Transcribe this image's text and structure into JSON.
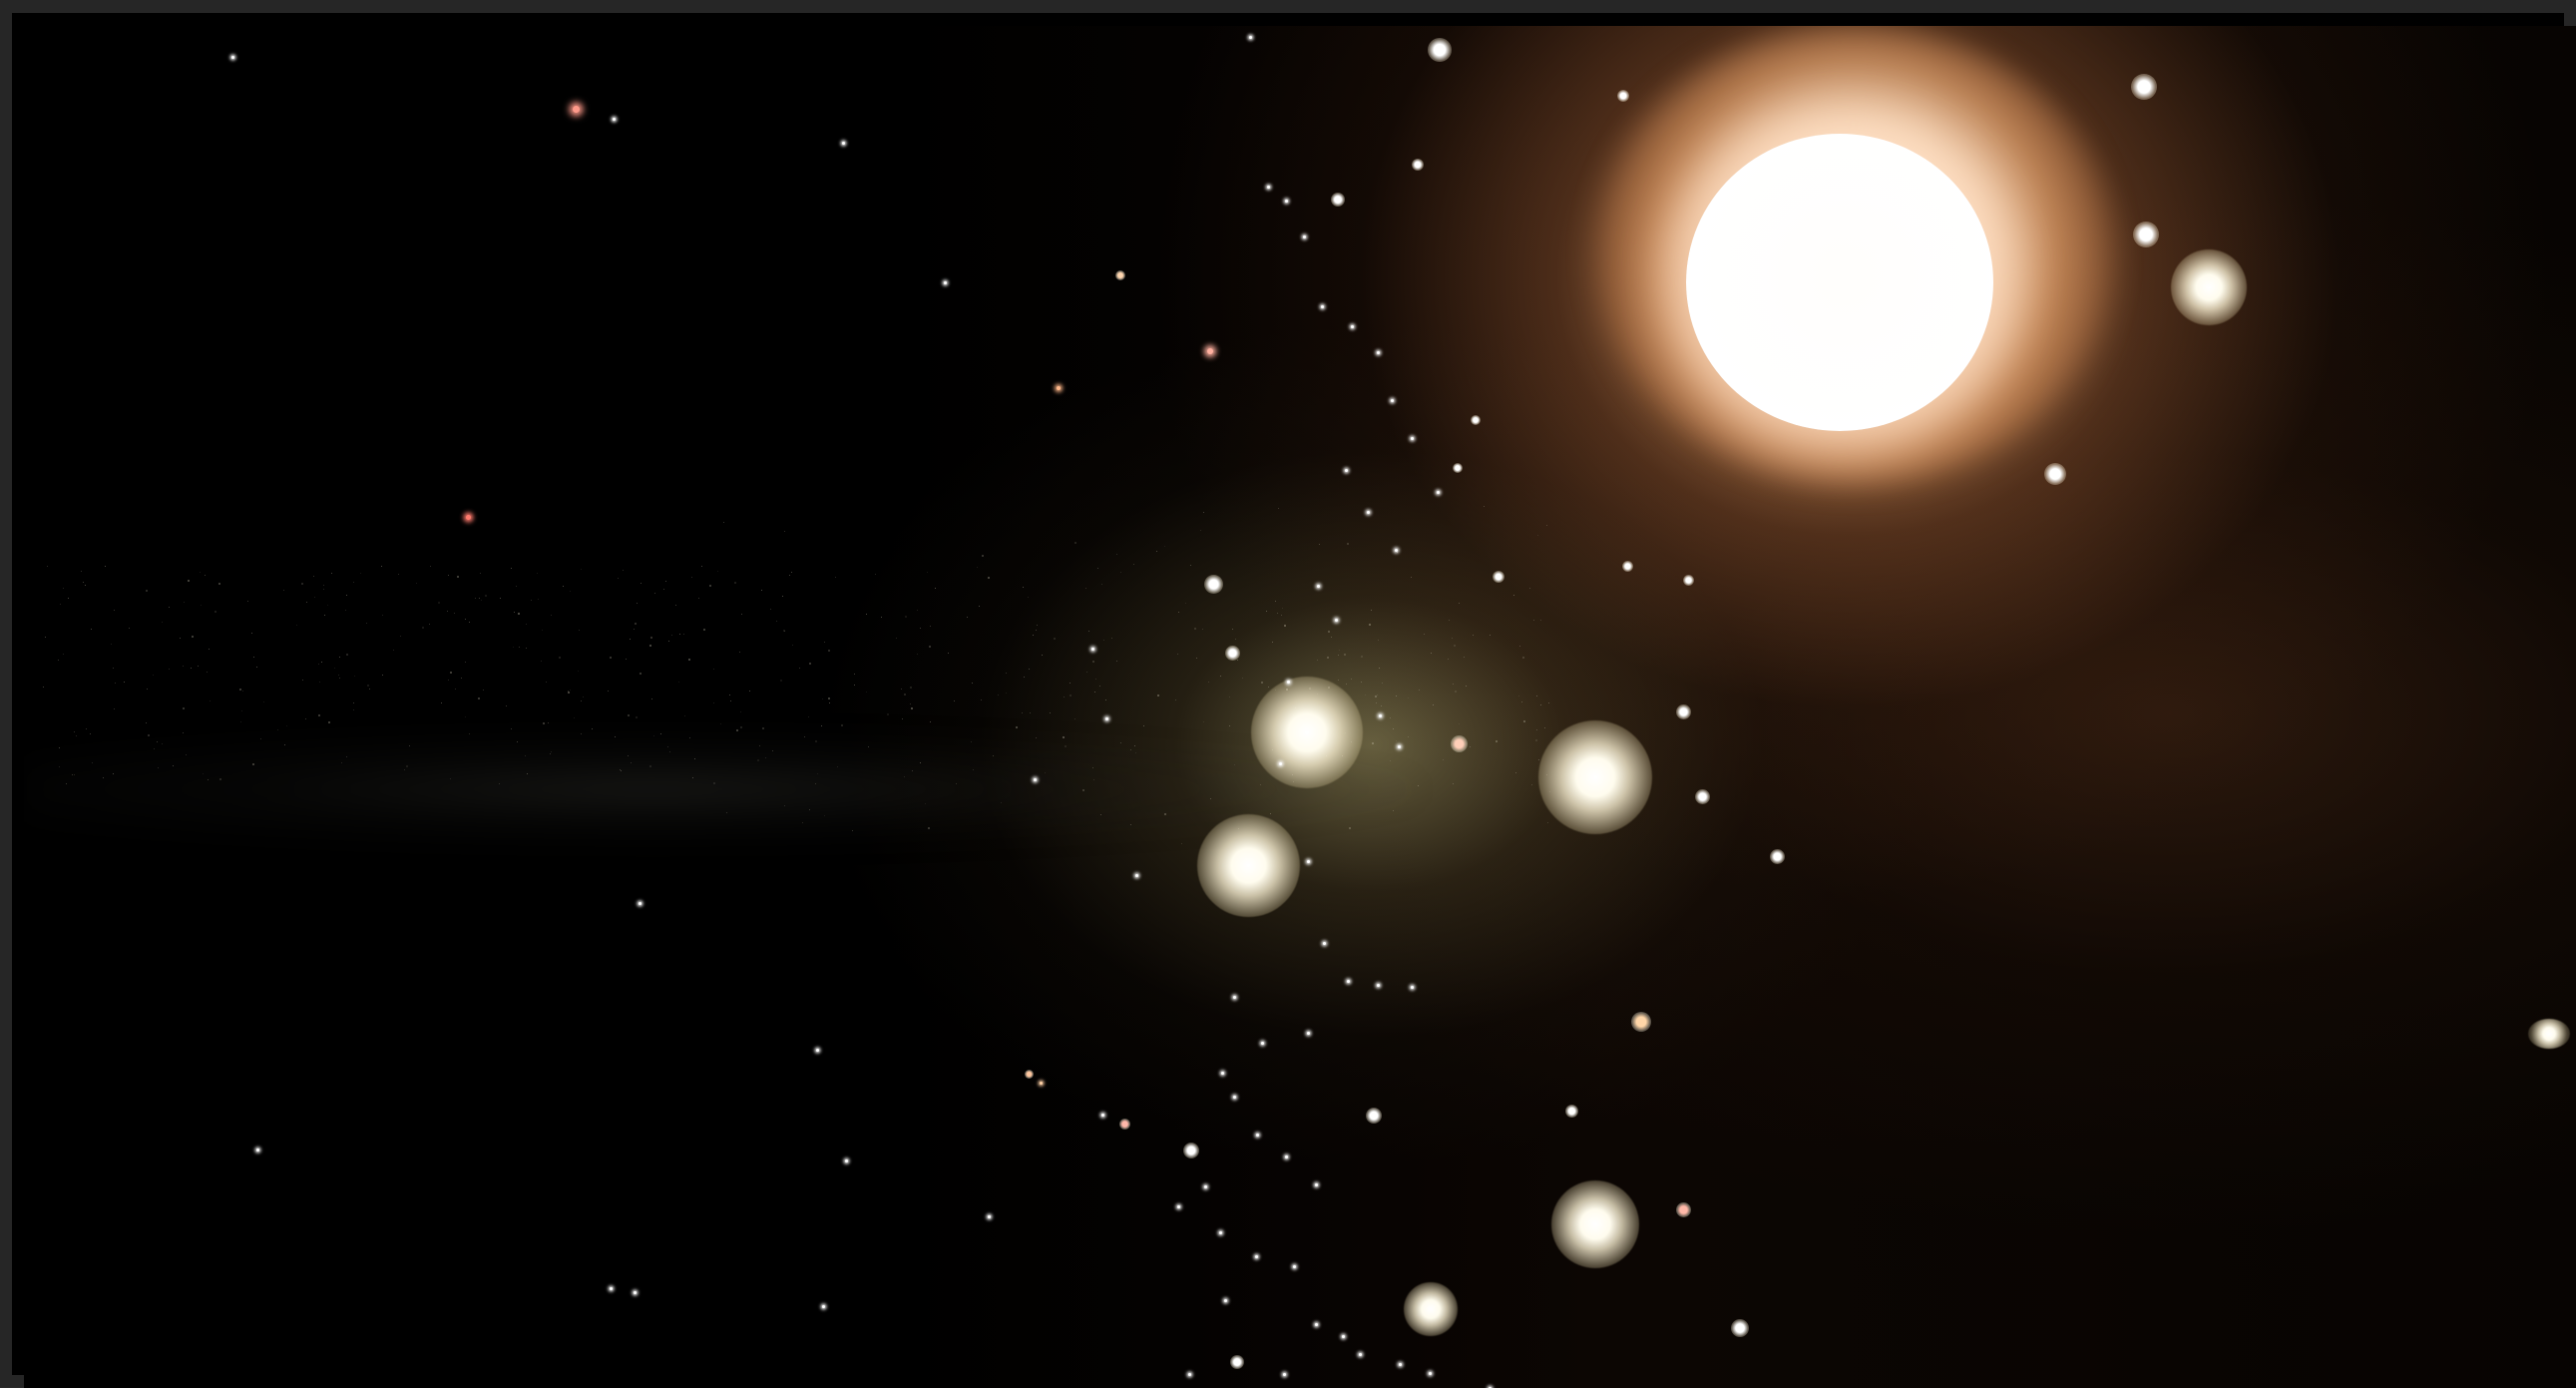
{
  "scene": {
    "colors": {
      "background": "#000000",
      "window_border": "#262626",
      "sun_core": "#ffffff",
      "sun_halo": "#e8a069",
      "cluster_glow": "#b2a870",
      "star_warm": "#f8dfbf",
      "star_red": "#ff8d7d",
      "star_white": "#ffffff"
    },
    "objects": {
      "sun": "sun-icon",
      "bright_stars": "star-icon",
      "faint_stars": "star-icon",
      "galaxy_band": "galaxy-band"
    }
  }
}
